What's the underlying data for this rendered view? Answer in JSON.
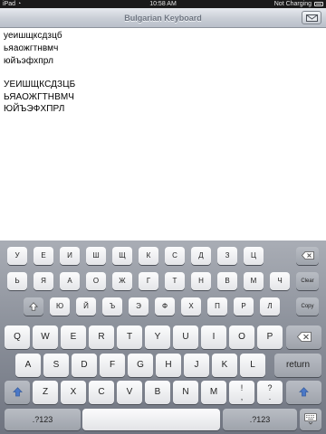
{
  "status_bar": {
    "carrier": "iPad",
    "time": "10:58 AM",
    "charging": "Not Charging"
  },
  "title_bar": {
    "title": "Bulgarian Keyboard",
    "mail_icon": "mail-icon"
  },
  "text_lines": [
    "уеишщксдзцб",
    "ьяаожгтнвмч",
    "юйъэфхпрл",
    "УЕИШЩКСДЗЦБ",
    "ЬЯАОЖГТНВМЧ",
    "ЮЙЪЭФХПРЛ"
  ],
  "bg_keyboard": {
    "row1": [
      "У",
      "Е",
      "И",
      "Ш",
      "Щ",
      "К",
      "С",
      "Д",
      "З",
      "Ц"
    ],
    "row2": [
      "Ь",
      "Я",
      "А",
      "О",
      "Ж",
      "Г",
      "Т",
      "Н",
      "В",
      "М",
      "Ч"
    ],
    "row3": [
      "Ю",
      "Й",
      "Ъ",
      "Э",
      "Ф",
      "Х",
      "П",
      "Р",
      "Л"
    ],
    "clear_label": "Clear",
    "copy_label": "Copy",
    "backspace_icon": "backspace-icon",
    "shift_icon": "shift-icon"
  },
  "en_keyboard": {
    "row1": [
      "Q",
      "W",
      "E",
      "R",
      "T",
      "Y",
      "U",
      "I",
      "O",
      "P"
    ],
    "row2": [
      "A",
      "S",
      "D",
      "F",
      "G",
      "H",
      "J",
      "K",
      "L"
    ],
    "row3": [
      "Z",
      "X",
      "C",
      "V",
      "B",
      "N",
      "M"
    ],
    "punct1_top": "!",
    "punct1_bottom": ",",
    "punct2_top": "?",
    "punct2_bottom": ".",
    "return_label": "return",
    "numbers_label": ".?123",
    "backspace_icon": "backspace-icon",
    "shift_icon": "shift-icon",
    "keyboard_icon": "keyboard-hide-icon"
  }
}
